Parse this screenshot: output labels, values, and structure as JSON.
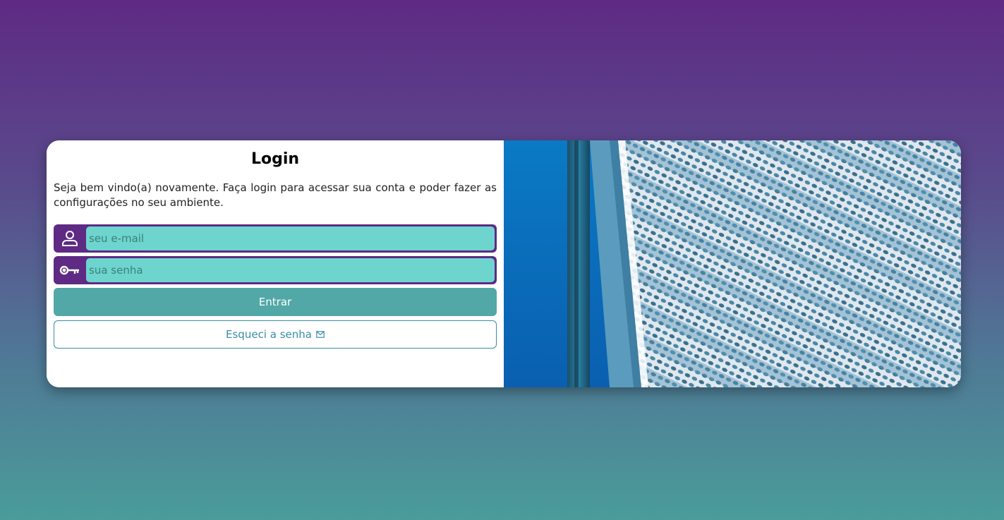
{
  "login": {
    "title": "Login",
    "description": "Seja bem vindo(a) novamente. Faça login para acessar sua conta e poder fazer as configurações no seu ambiente.",
    "email_placeholder": "seu e-mail",
    "password_placeholder": "sua senha",
    "enter_label": "Entrar",
    "forgot_label": "Esqueci a senha"
  },
  "icons": {
    "email": "user-icon",
    "password": "key-icon",
    "forgot": "mail-icon"
  },
  "colors": {
    "accent_purple": "#5e2a84",
    "input_teal": "#6dd5ce",
    "button_teal": "#52a8a6",
    "link_teal": "#3a8da1"
  }
}
